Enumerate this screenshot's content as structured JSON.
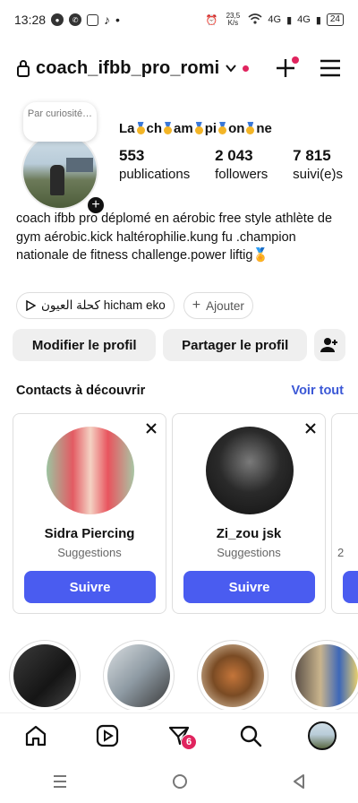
{
  "status_bar": {
    "time": "13:28",
    "network_speed": "23,5 K/s",
    "signal_1": "4G",
    "signal_2": "4G",
    "battery": "24"
  },
  "header": {
    "username": "coach_ifbb_pro_romi",
    "icons": [
      "lock-icon",
      "chevron-down-icon",
      "plus-icon",
      "menu-icon"
    ],
    "accent_color": "#e0245e"
  },
  "profile": {
    "note_text": "Par curiosité…",
    "display_name_parts": [
      "La",
      "ch",
      "am",
      "pi",
      "on",
      "ne"
    ],
    "stats": [
      {
        "value": "553",
        "label": "publications"
      },
      {
        "value": "2 043",
        "label": "followers"
      },
      {
        "value": "7 815",
        "label": "suivi(e)s"
      }
    ],
    "bio": "coach ifbb pro déplomé en aérobic free style athlète de gym aérobic.kick haltérophilie.kung fu .champion nationale de fitness challenge.power liftig🏅"
  },
  "chips": {
    "music_label": "كحلة العيون hicham eko",
    "add_label": "Ajouter"
  },
  "actions": {
    "edit_label": "Modifier le profil",
    "share_label": "Partager le profil"
  },
  "discover": {
    "title": "Contacts à découvrir",
    "see_all": "Voir tout",
    "cards": [
      {
        "name": "Sidra Piercing",
        "subtitle": "Suggestions",
        "button": "Suivre"
      },
      {
        "name": "Zi_zou jsk",
        "subtitle": "Suggestions",
        "button": "Suivre"
      }
    ],
    "partial_subtitle_fragment": "2",
    "button_color": "#4a5cf0"
  },
  "bottom_nav": {
    "items": [
      "home-icon",
      "reels-icon",
      "activity-icon",
      "search-icon",
      "profile-avatar"
    ],
    "badge_count": "6"
  }
}
